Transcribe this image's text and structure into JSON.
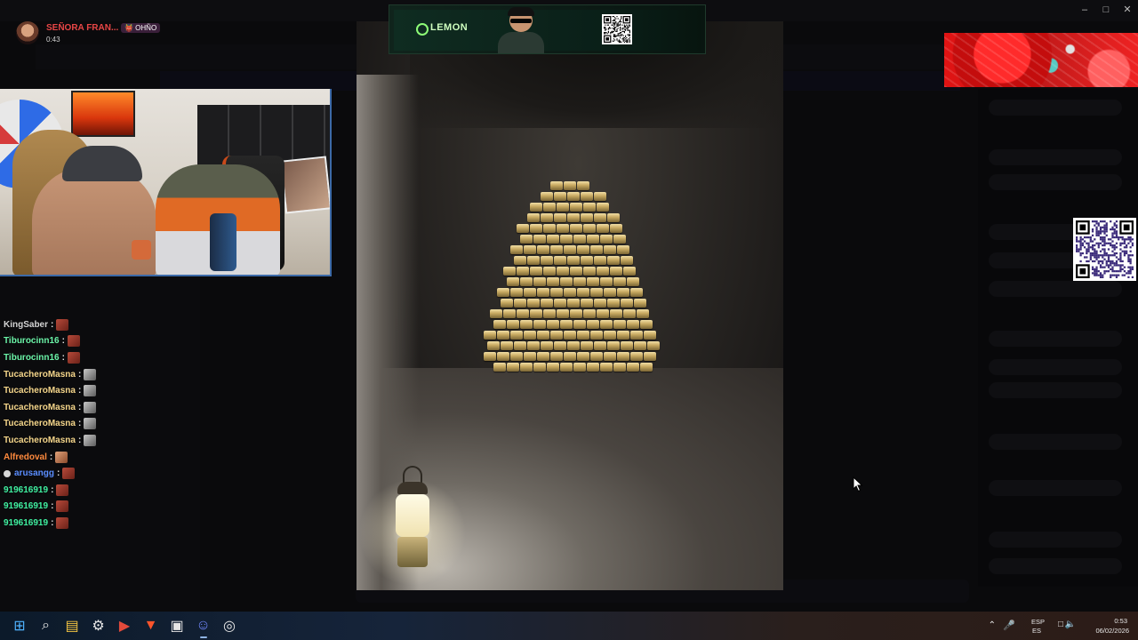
{
  "stream": {
    "streamer_name": "SEÑORA FRAN...",
    "tag": "👹 OHÑO",
    "timer": "0:43"
  },
  "banner": {
    "brand": "LEMON"
  },
  "chat": {
    "messages": [
      {
        "user": "KingSaber",
        "color": "#d3d3d3",
        "emote": "red",
        "mod": false
      },
      {
        "user": "Tiburocinn16",
        "color": "#6bf5a8",
        "emote": "red",
        "mod": false
      },
      {
        "user": "Tiburocinn16",
        "color": "#6bf5a8",
        "emote": "red",
        "mod": false
      },
      {
        "user": "TucacheroMasna",
        "color": "#f4d58a",
        "emote": "grey",
        "mod": false
      },
      {
        "user": "TucacheroMasna",
        "color": "#f4d58a",
        "emote": "grey",
        "mod": false
      },
      {
        "user": "TucacheroMasna",
        "color": "#f4d58a",
        "emote": "grey",
        "mod": false
      },
      {
        "user": "TucacheroMasna",
        "color": "#f4d58a",
        "emote": "grey",
        "mod": false
      },
      {
        "user": "TucacheroMasna",
        "color": "#f4d58a",
        "emote": "grey",
        "mod": false
      },
      {
        "user": "Alfredoval",
        "color": "#ff8a3d",
        "emote": "skin",
        "mod": false
      },
      {
        "user": "arusangg",
        "color": "#5a8dff",
        "emote": "red",
        "mod": true
      },
      {
        "user": "919616919",
        "color": "#3ff0a0",
        "emote": "red",
        "mod": false
      },
      {
        "user": "919616919",
        "color": "#3ff0a0",
        "emote": "red",
        "mod": false
      },
      {
        "user": "919616919",
        "color": "#3ff0a0",
        "emote": "red",
        "mod": false
      }
    ]
  },
  "taskbar": {
    "icons": [
      {
        "name": "windows-start-icon",
        "glyph": "⊞",
        "active": false
      },
      {
        "name": "search-icon",
        "glyph": "⌕",
        "active": false
      },
      {
        "name": "file-explorer-icon",
        "glyph": "▤",
        "active": false
      },
      {
        "name": "settings-icon",
        "glyph": "⚙",
        "active": false
      },
      {
        "name": "screen-recorder-icon",
        "glyph": "▶",
        "active": false
      },
      {
        "name": "brave-browser-icon",
        "glyph": "▼",
        "active": false
      },
      {
        "name": "app-window-icon",
        "glyph": "▣",
        "active": false
      },
      {
        "name": "discord-icon",
        "glyph": "☺",
        "active": true
      },
      {
        "name": "circle-app-icon",
        "glyph": "◎",
        "active": false
      }
    ],
    "tray": {
      "language": "ESP",
      "keyboard": "ES",
      "time": "0:53",
      "date": "06/02/2026"
    }
  },
  "window_controls": {
    "minimize": "–",
    "maximize": "□",
    "close": "✕"
  },
  "colors": {
    "streamer_name": "#e84646",
    "webcam_border": "#3c6aa8",
    "banner_accent": "#8dfc77",
    "overlay_red": "#e01313"
  }
}
